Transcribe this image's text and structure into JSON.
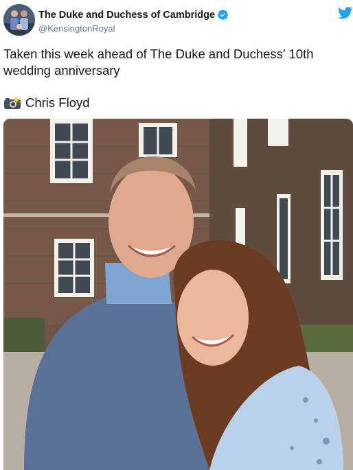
{
  "author": {
    "display_name": "The Duke and Duchess of Cambridge",
    "handle": "@KensingtonRoyal",
    "verified": true,
    "avatar_icon": "profile-photo-couple"
  },
  "tweet": {
    "text": "Taken this week ahead of The Duke and Duchess’ 10th wedding anniversary",
    "credit_icon": "camera-flash-icon",
    "credit": "Chris Floyd"
  },
  "media": {
    "description_icon": "photo-image",
    "type": "photo"
  },
  "colors": {
    "twitter_blue": "#1da1f2",
    "text": "#14171a",
    "secondary": "#657786"
  }
}
